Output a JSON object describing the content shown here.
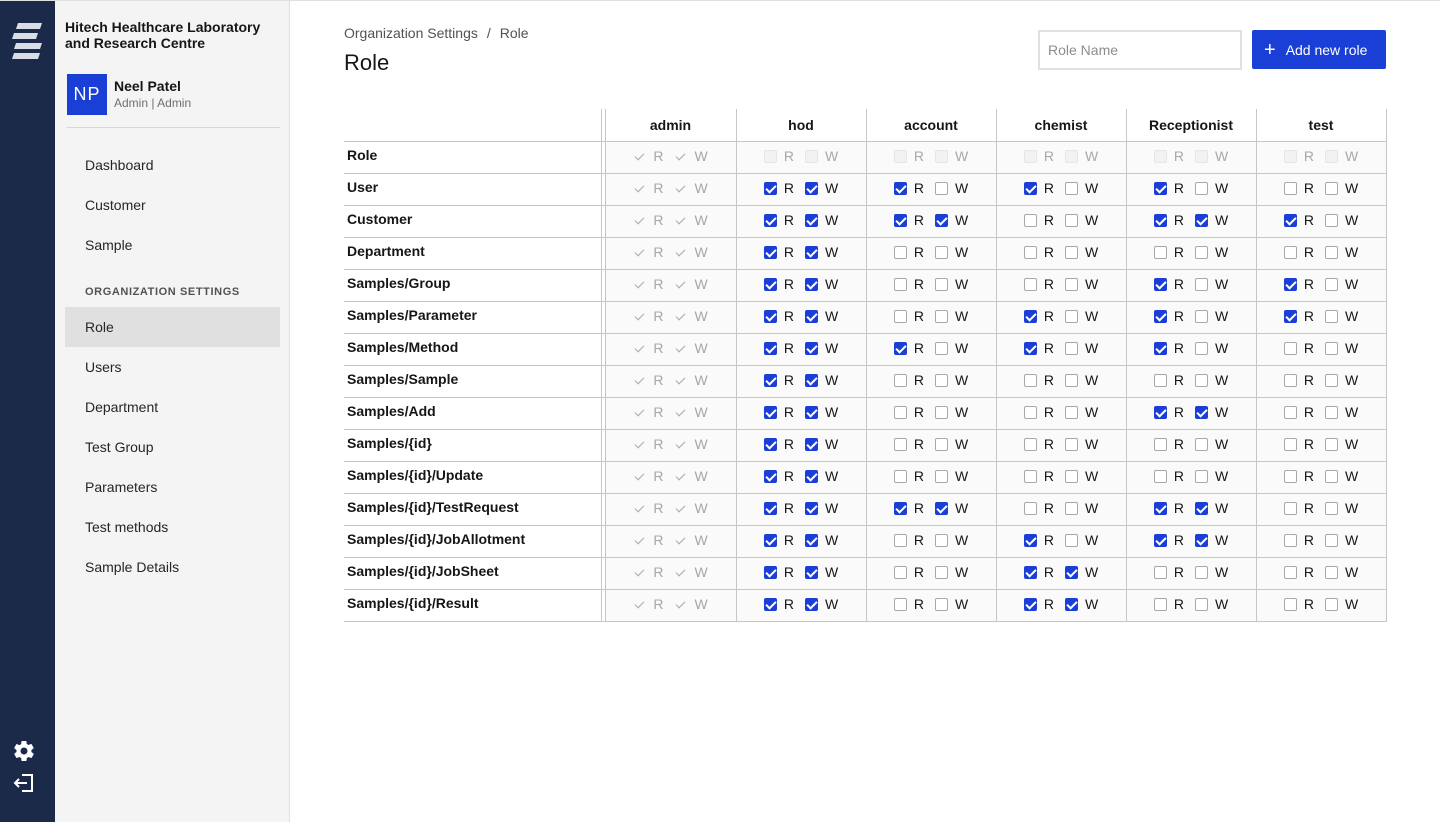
{
  "org": {
    "name": "Hitech Healthcare Laboratory and Research Centre"
  },
  "user": {
    "initials": "NP",
    "name": "Neel Patel",
    "role": "Admin | Admin"
  },
  "nav": {
    "items_top": [
      "Dashboard",
      "Customer",
      "Sample"
    ],
    "section_label": "ORGANIZATION SETTINGS",
    "items_org": [
      "Role",
      "Users",
      "Department",
      "Test Group",
      "Parameters",
      "Test methods",
      "Sample Details"
    ],
    "active": "Role"
  },
  "breadcrumb": {
    "parent": "Organization Settings",
    "separator": "/",
    "current": "Role"
  },
  "page": {
    "title": "Role"
  },
  "search": {
    "placeholder": "Role Name",
    "value": ""
  },
  "actions": {
    "add_label": "Add new role"
  },
  "icons": {
    "logo": "app-logo",
    "settings": "gear-icon",
    "logout": "logout-icon",
    "add": "plus-icon",
    "check": "checkmark-icon"
  },
  "colors": {
    "rail": "#1c2a4a",
    "accent": "#1a3fd6",
    "sidebar_bg": "#f4f4f4",
    "active_bg": "#e0e0e0"
  },
  "permission_labels": {
    "read": "R",
    "write": "W"
  },
  "roles": [
    "admin",
    "hod",
    "account",
    "chemist",
    "Receptionist",
    "test"
  ],
  "resources": [
    {
      "name": "Role",
      "perms": [
        [
          1,
          1
        ],
        [
          0,
          0
        ],
        [
          0,
          0
        ],
        [
          0,
          0
        ],
        [
          0,
          0
        ],
        [
          0,
          0
        ]
      ]
    },
    {
      "name": "User",
      "perms": [
        [
          1,
          1
        ],
        [
          1,
          1
        ],
        [
          1,
          0
        ],
        [
          1,
          0
        ],
        [
          1,
          0
        ],
        [
          0,
          0
        ]
      ]
    },
    {
      "name": "Customer",
      "perms": [
        [
          1,
          1
        ],
        [
          1,
          1
        ],
        [
          1,
          1
        ],
        [
          0,
          0
        ],
        [
          1,
          1
        ],
        [
          1,
          0
        ]
      ]
    },
    {
      "name": "Department",
      "perms": [
        [
          1,
          1
        ],
        [
          1,
          1
        ],
        [
          0,
          0
        ],
        [
          0,
          0
        ],
        [
          0,
          0
        ],
        [
          0,
          0
        ]
      ]
    },
    {
      "name": "Samples/Group",
      "perms": [
        [
          1,
          1
        ],
        [
          1,
          1
        ],
        [
          0,
          0
        ],
        [
          0,
          0
        ],
        [
          1,
          0
        ],
        [
          1,
          0
        ]
      ]
    },
    {
      "name": "Samples/Parameter",
      "perms": [
        [
          1,
          1
        ],
        [
          1,
          1
        ],
        [
          0,
          0
        ],
        [
          1,
          0
        ],
        [
          1,
          0
        ],
        [
          1,
          0
        ]
      ]
    },
    {
      "name": "Samples/Method",
      "perms": [
        [
          1,
          1
        ],
        [
          1,
          1
        ],
        [
          1,
          0
        ],
        [
          1,
          0
        ],
        [
          1,
          0
        ],
        [
          0,
          0
        ]
      ]
    },
    {
      "name": "Samples/Sample",
      "perms": [
        [
          1,
          1
        ],
        [
          1,
          1
        ],
        [
          0,
          0
        ],
        [
          0,
          0
        ],
        [
          0,
          0
        ],
        [
          0,
          0
        ]
      ]
    },
    {
      "name": "Samples/Add",
      "perms": [
        [
          1,
          1
        ],
        [
          1,
          1
        ],
        [
          0,
          0
        ],
        [
          0,
          0
        ],
        [
          1,
          1
        ],
        [
          0,
          0
        ]
      ]
    },
    {
      "name": "Samples/{id}",
      "perms": [
        [
          1,
          1
        ],
        [
          1,
          1
        ],
        [
          0,
          0
        ],
        [
          0,
          0
        ],
        [
          0,
          0
        ],
        [
          0,
          0
        ]
      ]
    },
    {
      "name": "Samples/{id}/Update",
      "perms": [
        [
          1,
          1
        ],
        [
          1,
          1
        ],
        [
          0,
          0
        ],
        [
          0,
          0
        ],
        [
          0,
          0
        ],
        [
          0,
          0
        ]
      ]
    },
    {
      "name": "Samples/{id}/TestRequest",
      "perms": [
        [
          1,
          1
        ],
        [
          1,
          1
        ],
        [
          1,
          1
        ],
        [
          0,
          0
        ],
        [
          1,
          1
        ],
        [
          0,
          0
        ]
      ]
    },
    {
      "name": "Samples/{id}/JobAllotment",
      "perms": [
        [
          1,
          1
        ],
        [
          1,
          1
        ],
        [
          0,
          0
        ],
        [
          1,
          0
        ],
        [
          1,
          1
        ],
        [
          0,
          0
        ]
      ]
    },
    {
      "name": "Samples/{id}/JobSheet",
      "perms": [
        [
          1,
          1
        ],
        [
          1,
          1
        ],
        [
          0,
          0
        ],
        [
          1,
          1
        ],
        [
          0,
          0
        ],
        [
          0,
          0
        ]
      ]
    },
    {
      "name": "Samples/{id}/Result",
      "perms": [
        [
          1,
          1
        ],
        [
          1,
          1
        ],
        [
          0,
          0
        ],
        [
          1,
          1
        ],
        [
          0,
          0
        ],
        [
          0,
          0
        ]
      ]
    }
  ],
  "disabled_rules": {
    "admin_column_disabled": true,
    "role_row_disabled": true
  }
}
